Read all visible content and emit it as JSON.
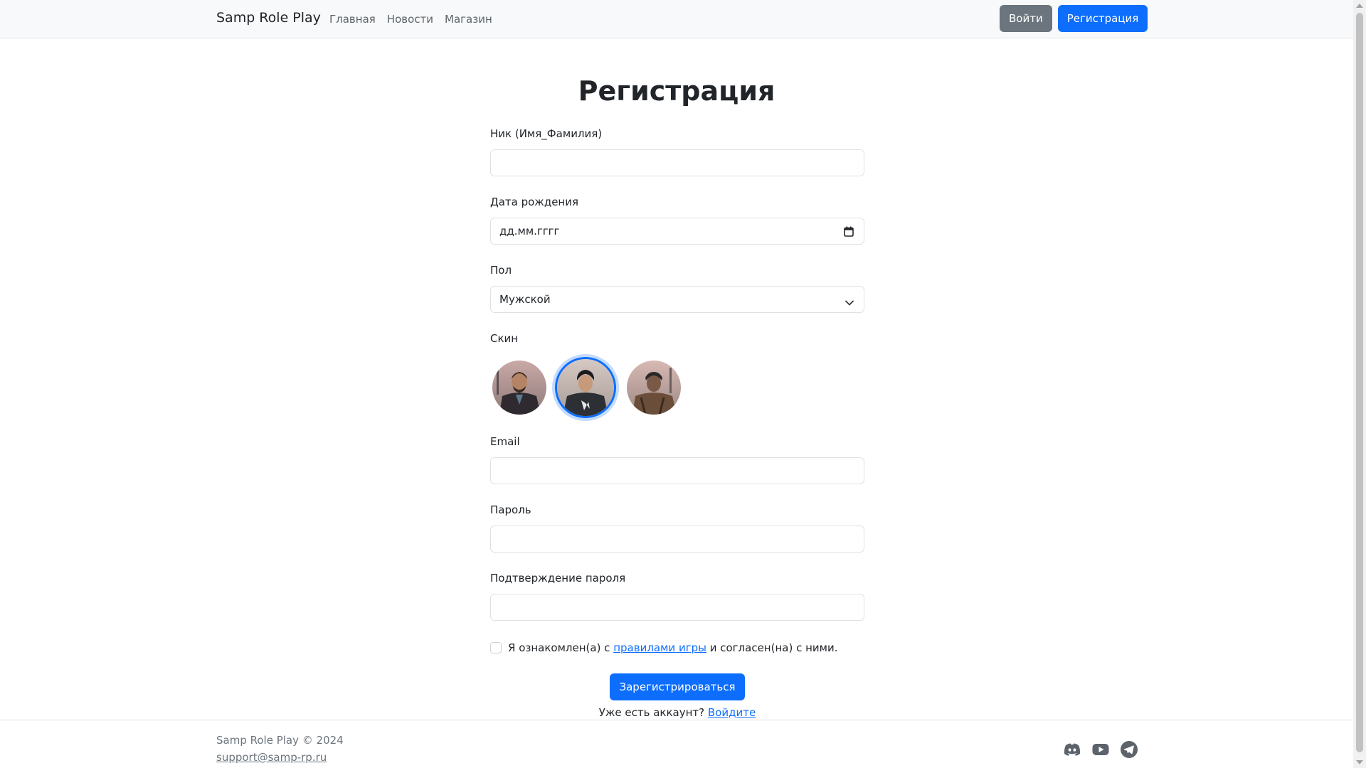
{
  "navbar": {
    "brand": "Samp Role Play",
    "links": [
      "Главная",
      "Новости",
      "Магазин"
    ],
    "login_label": "Войти",
    "register_label": "Регистрация"
  },
  "page_title": "Регистрация",
  "form": {
    "nick_label": "Ник (Имя_Фамилия)",
    "nick_value": "",
    "birth_label": "Дата рождения",
    "birth_placeholder": "дд.мм.гггг",
    "gender_label": "Пол",
    "gender_selected": "Мужской",
    "skin_label": "Скин",
    "skins": [
      {
        "name": "skin-1",
        "selected": false
      },
      {
        "name": "skin-2",
        "selected": true
      },
      {
        "name": "skin-3",
        "selected": false
      }
    ],
    "email_label": "Email",
    "password_label": "Пароль",
    "confirm_label": "Подтверждение пароля",
    "agree_prefix": "Я ознакомлен(а) с",
    "agree_link": "правилами игры",
    "agree_suffix": "и согласен(на) с ними.",
    "submit_label": "Зарегистрироваться",
    "login_prompt": "Уже есть аккаунт?",
    "login_link": "Войдите"
  },
  "footer": {
    "copyright": "Samp Role Play  © 2024",
    "email": "support@samp-rp.ru",
    "socials": [
      "discord-icon",
      "youtube-icon",
      "telegram-icon"
    ]
  },
  "colors": {
    "primary": "#0d6efd",
    "secondary": "#6c757d",
    "navbar_bg": "#f8f9fa"
  }
}
